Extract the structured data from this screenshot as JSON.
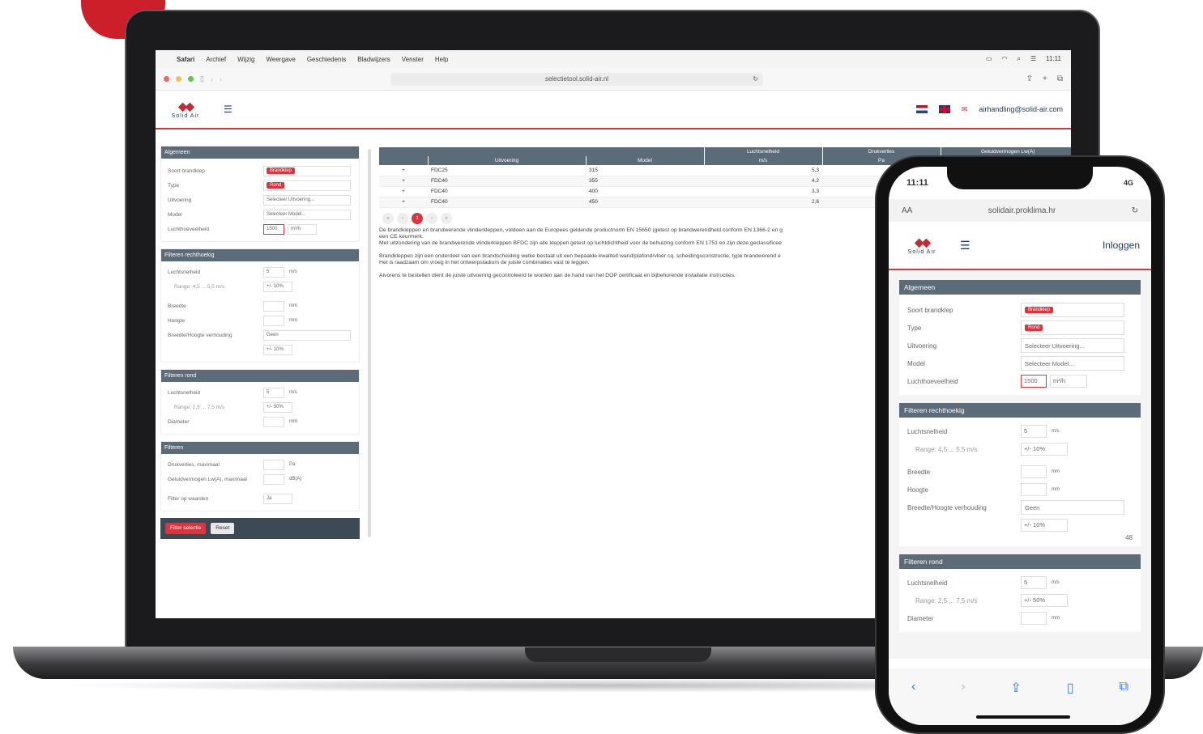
{
  "mac": {
    "menu": [
      "Safari",
      "Archief",
      "Wijzig",
      "Weergave",
      "Geschiedenis",
      "Bladwijzers",
      "Venster",
      "Help"
    ],
    "time": "11:11",
    "url": "selectietool.solid-air.nl"
  },
  "app": {
    "logo": "Solid Air",
    "email": "airhandling@solid-air.com"
  },
  "panels": {
    "algemeen": {
      "title": "Algemeen",
      "soort_label": "Soort brandklep",
      "soort_value": "Brandklep",
      "type_label": "Type",
      "type_value": "Rond",
      "uitvoering_label": "Uitvoering",
      "uitvoering_value": "Selecteer Uitvoering...",
      "model_label": "Model",
      "model_value": "Selecteer Model...",
      "lucht_label": "Luchthoeveelheid",
      "lucht_value": "1500",
      "lucht_unit": "m³/h"
    },
    "recht": {
      "title": "Filteren rechthoekig",
      "snel_label": "Luchtsnelheid",
      "snel_value": "5",
      "snel_unit": "m/s",
      "range": "Range: 4,5 ... 5,5 m/s",
      "tol": "+/- 10%",
      "breedte": "Breedte",
      "hoogte": "Hoogte",
      "mm": "mm",
      "verh_label": "Breedte/Hoogte verhouding",
      "verh_value": "Geen",
      "tol2": "+/- 10%"
    },
    "rond": {
      "title": "Filteren rond",
      "snel_label": "Luchtsnelheid",
      "snel_value": "5",
      "snel_unit": "m/s",
      "range": "Range: 2,5 ... 7,5 m/s",
      "tol": "+/- 50%",
      "diam": "Diameter",
      "mm": "mm"
    },
    "filteren": {
      "title": "Filteren",
      "druk": "Drukverlies, maximaal",
      "druk_unit": "Pa",
      "geluid": "Geluidvermogen Lw(A), maximaal",
      "geluid_unit": "dB(A)",
      "filter": "Filter op waarden",
      "filter_value": "Ja"
    },
    "buttons": {
      "filter": "Filter selectie",
      "reset": "Reset"
    }
  },
  "table": {
    "group_headers": [
      "Luchtsnelheid",
      "Drukverlies",
      "Geluidvermogen Lw(A)"
    ],
    "headers": [
      "Uitvoering",
      "Model",
      "m/s",
      "Pa"
    ],
    "rows": [
      {
        "u": "FDC25",
        "m": "315",
        "v": "5,3"
      },
      {
        "u": "FDC40",
        "m": "355",
        "v": "4,2"
      },
      {
        "u": "FDC40",
        "m": "400",
        "v": "3,3"
      },
      {
        "u": "FDC40",
        "m": "450",
        "v": "2,6"
      }
    ],
    "page": "1"
  },
  "desc": {
    "p1": "De brandkleppen en brandwerende vlinderkleppen, voldoen aan de Europees geldende productnorm EN 15650 (getest op brandwerendheid conform EN 1366-2 en g",
    "p1b": "een CE keurmerk.",
    "p1c": "Met uitzondering van de brandwerende vlinderkleppen BFDC zijn alle kleppen getest op luchtdichtheid voor de behuizing conform EN 1751 en zijn deze geclassificee",
    "p2": "Brandkleppen zijn een onderdeel van een brandscheiding welke bestaat uit een bepaalde kwaliteit wand/plafond/vloer cq. scheidingsconstructie, type brandwerend e",
    "p2b": "Het is raadzaam om vroeg in het ontwerpstadium de juiste combinaties vast te leggen.",
    "p3": "Alvorens te bestellen dient de juiste uitvoering gecontroleerd te worden aan de hand van het DOP certificaat en bijbehorende installatie instructies."
  },
  "phone": {
    "time": "11:11",
    "network": "4G",
    "aa": "AA",
    "url": "solidair.proklima.hr",
    "login": "Inloggen",
    "counter": "48"
  }
}
